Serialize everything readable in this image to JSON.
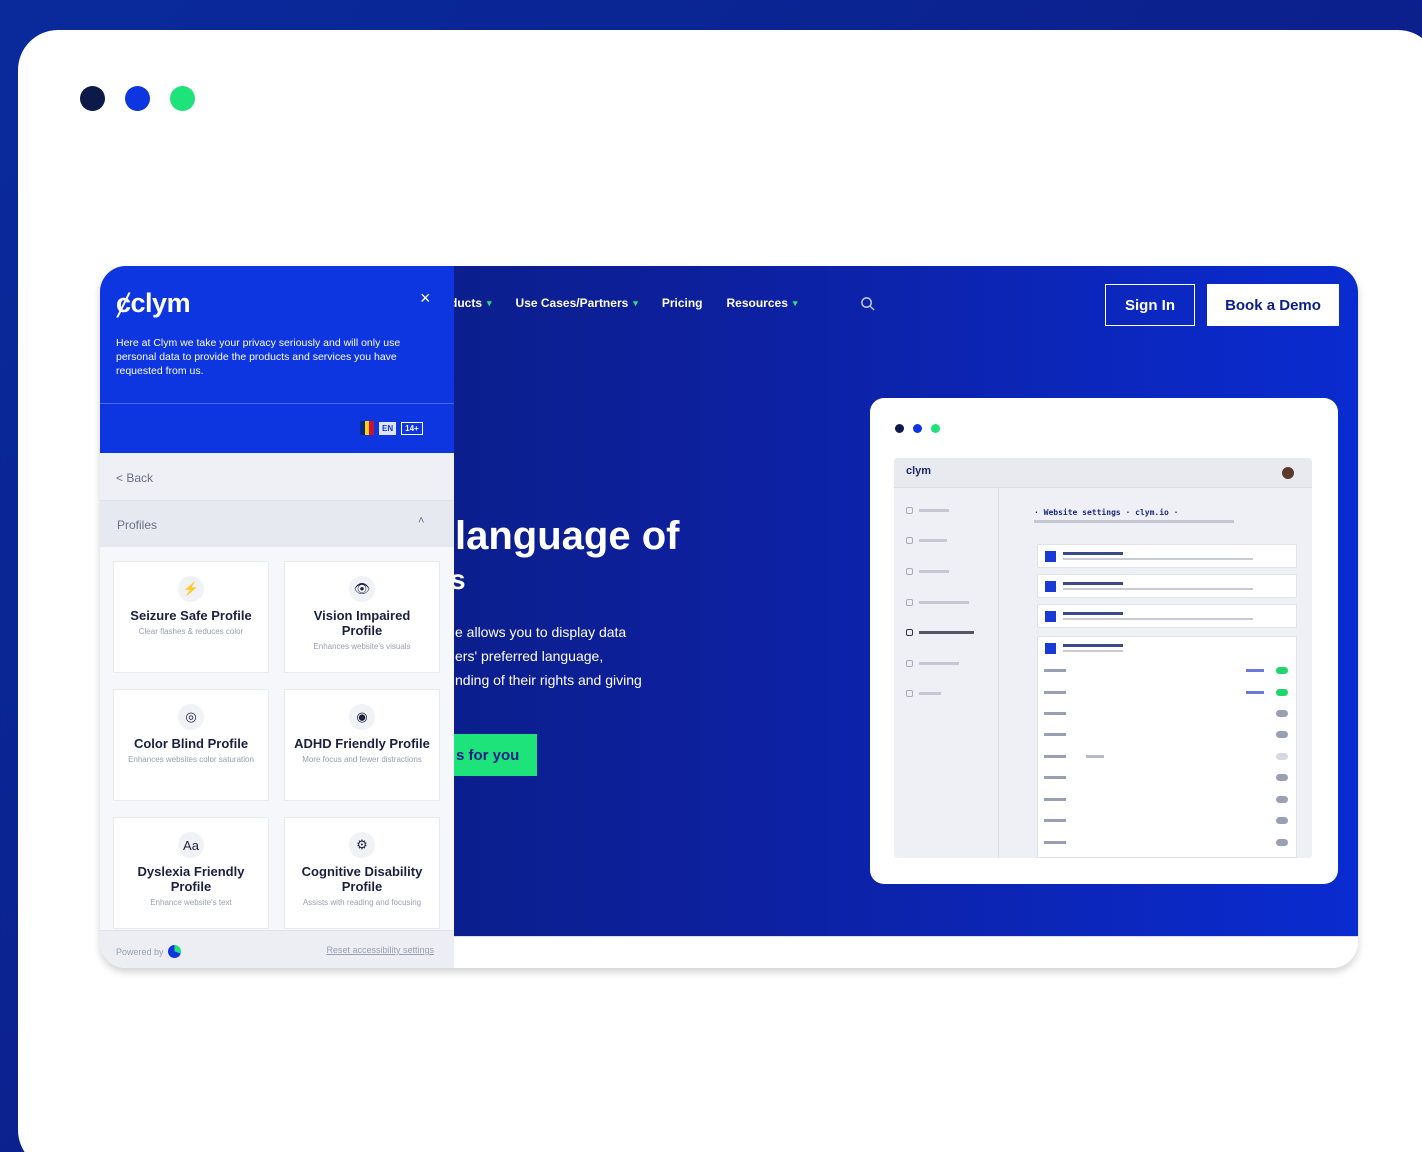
{
  "colors": {
    "brand_blue": "#0d35e0",
    "dark_navy": "#0b1f8a",
    "accent_green": "#1ee27a"
  },
  "window_dots": [
    "#0c1a4a",
    "#0d35e0",
    "#1ee27a"
  ],
  "nav": {
    "items": [
      {
        "label": "ducts",
        "caret": "▾"
      },
      {
        "label": "Use Cases/Partners",
        "caret": "▾"
      },
      {
        "label": "Pricing",
        "caret": ""
      },
      {
        "label": "Resources",
        "caret": "▾"
      }
    ],
    "search_icon": "search-icon",
    "signin": "Sign In",
    "demo": "Book a Demo"
  },
  "hero": {
    "title": "language of",
    "title_2": "s",
    "lines": [
      "e allows you to display data",
      "ers' preferred language,",
      "nding of their rights and giving"
    ],
    "cta": "s for you"
  },
  "preview": {
    "logo": "clym",
    "heading": "· Website settings · clym.io ·"
  },
  "panel": {
    "logo": "clym",
    "close": "×",
    "intro": "Here at Clym we take your privacy seriously and will only use personal data to provide the products and services you have requested from us.",
    "lang_en": "EN",
    "lang_size": "14+",
    "back": "< Back",
    "profiles_label": "Profiles",
    "profiles_caret": "˄",
    "cards": [
      {
        "icon": "⚡",
        "name": "Seizure Safe Profile",
        "desc": "Clear flashes & reduces color"
      },
      {
        "icon": "👁",
        "name": "Vision Impaired Profile",
        "desc": "Enhances website's visuals"
      },
      {
        "icon": "◎",
        "name": "Color Blind Profile",
        "desc": "Enhances websites color saturation"
      },
      {
        "icon": "◉",
        "name": "ADHD Friendly Profile",
        "desc": "More focus and fewer distractions"
      },
      {
        "icon": "Aa",
        "name": "Dyslexia Friendly Profile",
        "desc": "Enhance website's text"
      },
      {
        "icon": "⚙",
        "name": "Cognitive Disability Profile",
        "desc": "Assists with reading and focusing"
      }
    ],
    "powered_by": "Powered by",
    "reset": "Reset accessibility settings"
  }
}
